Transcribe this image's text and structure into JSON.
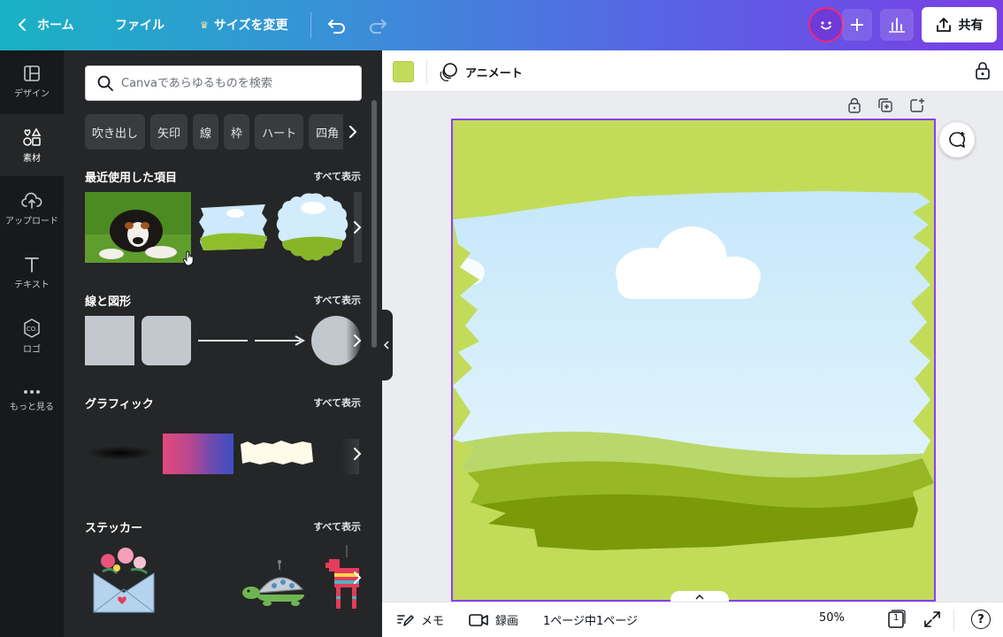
{
  "topbar": {
    "home_label": "ホーム",
    "file_label": "ファイル",
    "resize_label": "サイズを変更",
    "share_label": "共有"
  },
  "rail": {
    "items": [
      {
        "label": "デザイン",
        "icon": "layout-icon"
      },
      {
        "label": "素材",
        "icon": "shapes-icon"
      },
      {
        "label": "アップロード",
        "icon": "cloud-upload-icon"
      },
      {
        "label": "テキスト",
        "icon": "text-icon"
      },
      {
        "label": "ロゴ",
        "icon": "logo-icon"
      },
      {
        "label": "もっと見る",
        "icon": "more-icon"
      }
    ]
  },
  "panel": {
    "search_placeholder": "Canvaであらゆるものを検索",
    "chips": [
      "吹き出し",
      "矢印",
      "線",
      "枠",
      "ハート",
      "四角"
    ],
    "sections": {
      "recent": {
        "title": "最近使用した項目",
        "more": "すべて表示"
      },
      "lines_shapes": {
        "title": "線と図形",
        "more": "すべて表示"
      },
      "graphics": {
        "title": "グラフィック",
        "more": "すべて表示"
      },
      "stickers": {
        "title": "ステッカー",
        "more": "すべて表示"
      }
    }
  },
  "context_bar": {
    "color": "#c2dc5a",
    "animate_label": "アニメート"
  },
  "bottombar": {
    "notes_label": "メモ",
    "record_label": "録画",
    "page_info": "1ページ中1ページ",
    "zoom": "50%",
    "page_number": "1",
    "help": "?"
  },
  "colors": {
    "accent": "#8b3dff",
    "design_bg": "#c2dc5a",
    "sky_top": "#bfe4fa",
    "grass": "#7a9a0a"
  }
}
